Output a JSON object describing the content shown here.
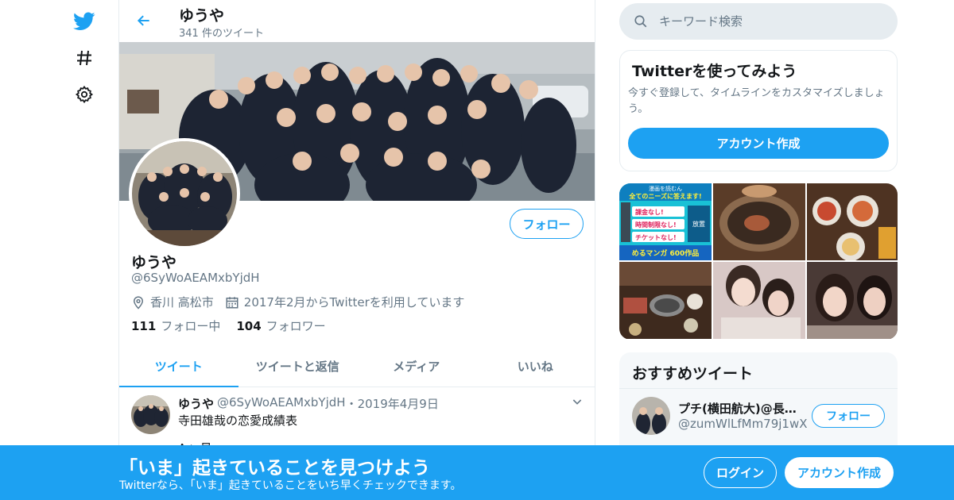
{
  "colors": {
    "accent": "#1da1f2",
    "text": "#14171a",
    "muted": "#657786",
    "border": "#e6ecf0"
  },
  "nav": {
    "items": [
      {
        "icon": "twitter-bird-icon"
      },
      {
        "icon": "hashtag-icon"
      },
      {
        "icon": "gear-icon"
      }
    ]
  },
  "header": {
    "name": "ゆうや",
    "tweet_count": "341 件のツイート"
  },
  "profile": {
    "follow_label": "フォロー",
    "name": "ゆうや",
    "handle": "@6SyWoAEAMxbYjdH",
    "location": "香川 高松市",
    "joined": "2017年2月からTwitterを利用しています",
    "following_count": "111",
    "following_label": "フォロー中",
    "followers_count": "104",
    "followers_label": "フォロワー"
  },
  "tabs": [
    {
      "label": "ツイート",
      "active": true
    },
    {
      "label": "ツイートと返信",
      "active": false
    },
    {
      "label": "メディア",
      "active": false
    },
    {
      "label": "いいね",
      "active": false
    }
  ],
  "tweet": {
    "name": "ゆうや",
    "handle": "@6SyWoAEAMxbYjdH",
    "date": "・2019年4月9日",
    "text": "寺田雄哉の恋愛成績表",
    "text2": "A+ 見"
  },
  "search": {
    "placeholder": "キーワード検索"
  },
  "signup": {
    "title": "Twitterを使ってみよう",
    "body": "今すぐ登録して、タイムラインをカスタマイズしましょう。",
    "button": "アカウント作成"
  },
  "media_ad": {
    "line1": "漫画を読むん",
    "line2": "全てのニーズに答えます!",
    "item1": "課金なし!",
    "item2": "時間制限なし!",
    "item3": "チケットなし!",
    "side": "放置",
    "footer": "めるマンガ 600作品"
  },
  "reco": {
    "title": "おすすめツイート",
    "name": "プチ(横田航大)@長濱ねる推し",
    "handle": "@zumWlLfMm79j1wX",
    "follow": "フォロー"
  },
  "bottom": {
    "title": "「いま」起きていることを見つけよう",
    "subtitle": "Twitterなら、「いま」起きていることをいち早くチェックできます。",
    "login": "ログイン",
    "create": "アカウント作成"
  }
}
